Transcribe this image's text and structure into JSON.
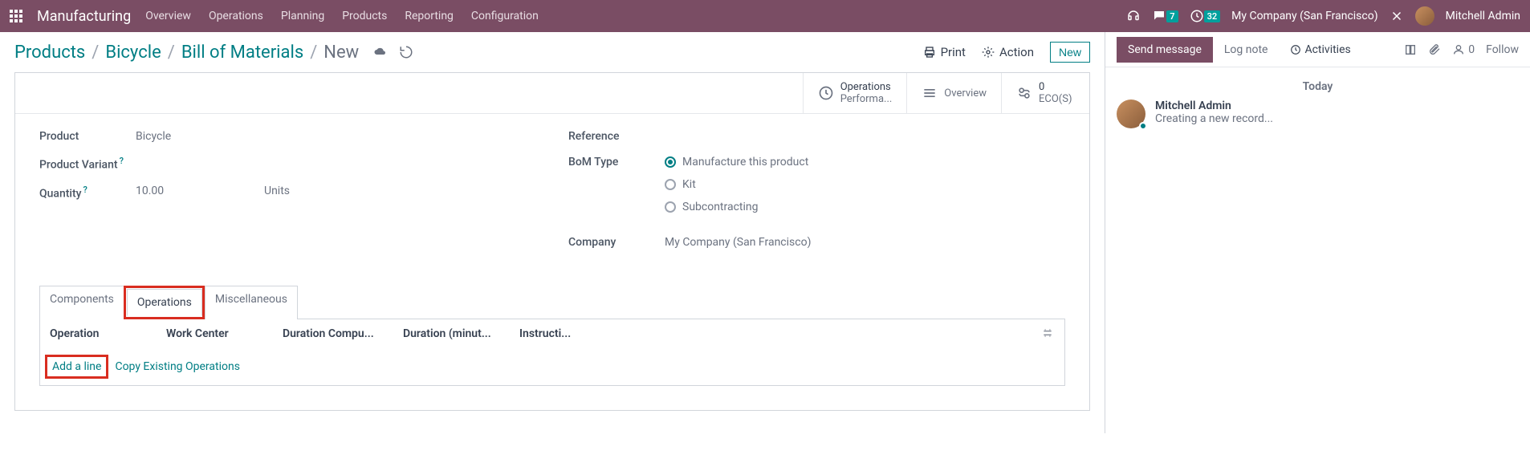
{
  "topbar": {
    "app_title": "Manufacturing",
    "menu": [
      "Overview",
      "Operations",
      "Planning",
      "Products",
      "Reporting",
      "Configuration"
    ],
    "chat_badge": "7",
    "clock_badge": "32",
    "company": "My Company (San Francisco)",
    "user": "Mitchell Admin"
  },
  "breadcrumb": {
    "items": [
      "Products",
      "Bicycle",
      "Bill of Materials"
    ],
    "current": "New",
    "print": "Print",
    "action": "Action",
    "new": "New"
  },
  "stat": {
    "ops_line1": "Operations",
    "ops_line2": "Performa...",
    "overview": "Overview",
    "eco_count": "0",
    "eco_label": "ECO(S)"
  },
  "form": {
    "product_label": "Product",
    "product_value": "Bicycle",
    "variant_label": "Product Variant",
    "qty_label": "Quantity",
    "qty_value": "10.00",
    "qty_unit": "Units",
    "ref_label": "Reference",
    "bom_label": "BoM Type",
    "bom_opts": [
      "Manufacture this product",
      "Kit",
      "Subcontracting"
    ],
    "company_label": "Company",
    "company_value": "My Company (San Francisco)"
  },
  "tabs": {
    "components": "Components",
    "operations": "Operations",
    "misc": "Miscellaneous"
  },
  "table": {
    "th1": "Operation",
    "th2": "Work Center",
    "th3": "Duration Compu...",
    "th4": "Duration (minut...",
    "th5": "Instructi...",
    "add_line": "Add a line",
    "copy_ops": "Copy Existing Operations"
  },
  "chatter": {
    "send": "Send message",
    "log": "Log note",
    "activities": "Activities",
    "followers": "0",
    "follow": "Follow",
    "today": "Today",
    "author": "Mitchell Admin",
    "content": "Creating a new record..."
  }
}
